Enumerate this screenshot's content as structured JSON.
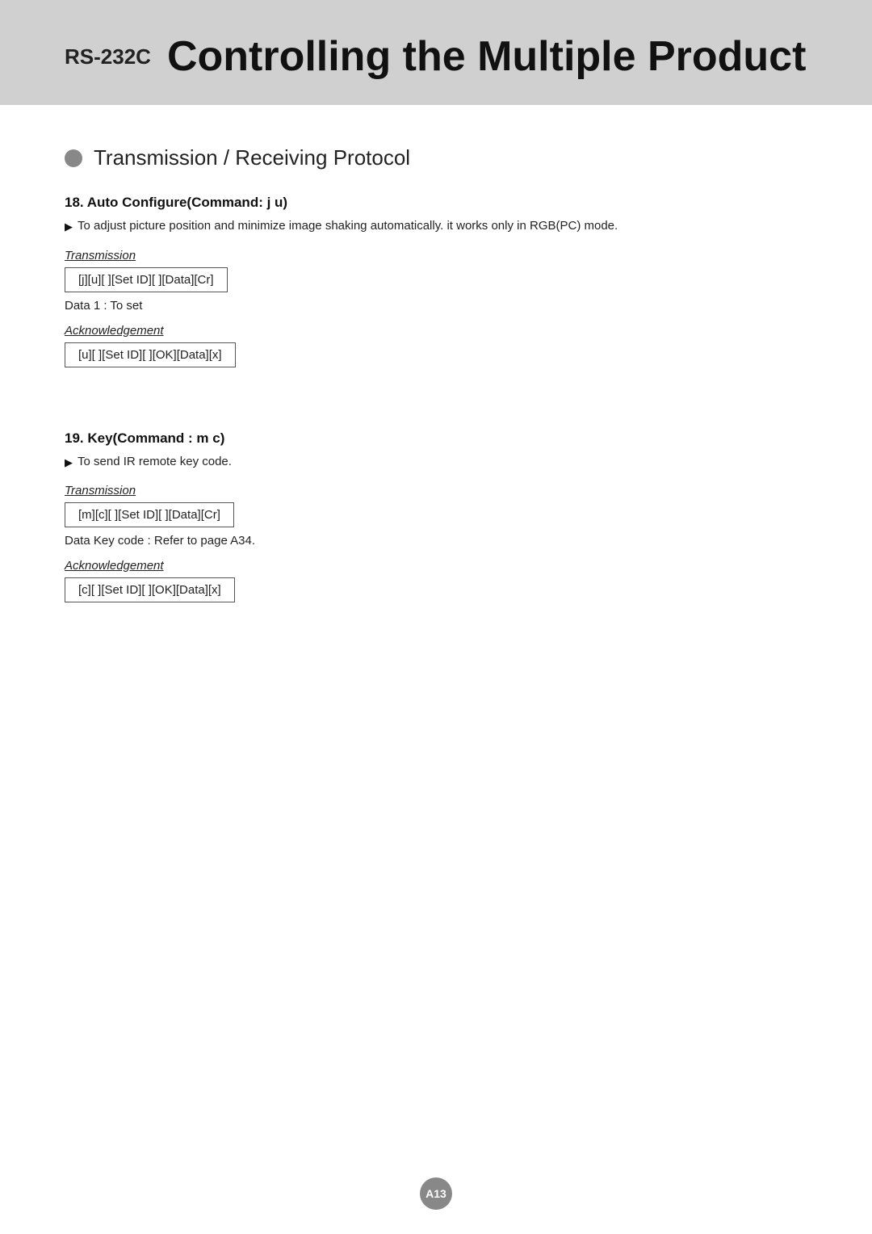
{
  "header": {
    "rs_label": "RS-232C",
    "title": "Controlling the Multiple Product"
  },
  "section_heading": "Transmission / Receiving Protocol",
  "commands": [
    {
      "id": "cmd18",
      "title": "18. Auto Configure(Command: j u)",
      "description": "To adjust picture position and minimize image shaking automatically. it works only in RGB(PC) mode.",
      "transmission_label": "Transmission",
      "transmission_code": "[j][u][  ][Set ID][  ][Data][Cr]",
      "data_note": "Data 1 : To set",
      "ack_label": "Acknowledgement",
      "ack_code": "[u][  ][Set ID][  ][OK][Data][x]"
    },
    {
      "id": "cmd19",
      "title": "19. Key(Command : m c)",
      "description": "To send IR remote key code.",
      "transmission_label": "Transmission",
      "transmission_code": "[m][c][  ][Set ID][  ][Data][Cr]",
      "data_note": "Data  Key code : Refer to page A34.",
      "ack_label": "Acknowledgement",
      "ack_code": "[c][  ][Set ID][  ][OK][Data][x]"
    }
  ],
  "page_number": "A13"
}
